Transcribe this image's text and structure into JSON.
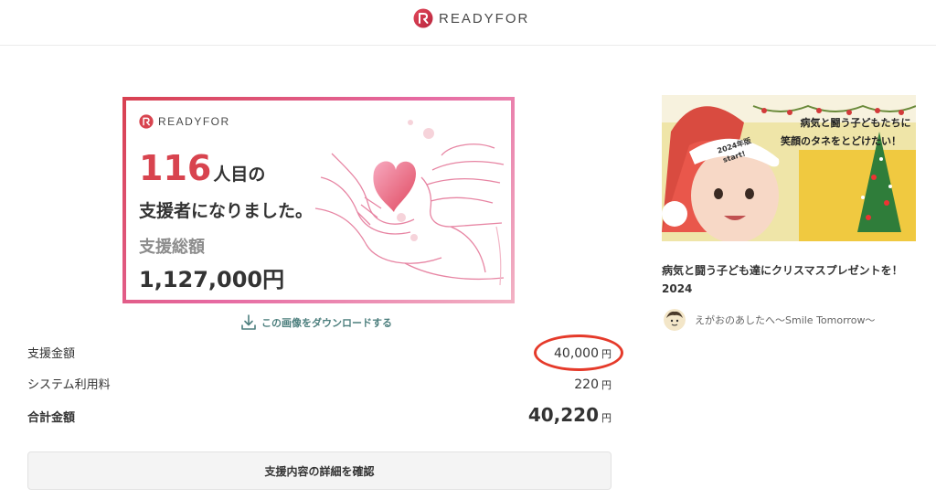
{
  "header": {
    "brand": "READYFOR"
  },
  "card": {
    "brand": "READYFOR",
    "count_number": "116",
    "count_suffix": "人目の",
    "line2": "支援者になりました。",
    "total_label": "支援総額",
    "total_value": "1,127,000円"
  },
  "download": {
    "label": "この画像をダウンロードする"
  },
  "summary": {
    "support_label": "支援金額",
    "support_amount": "40,000",
    "fee_label": "システム利用料",
    "fee_amount": "220",
    "total_label": "合計金額",
    "total_amount": "40,220",
    "unit": "円"
  },
  "detail_button": {
    "label": "支援内容の詳細を確認"
  },
  "project": {
    "image_caption_line1": "病気と闘う子どもたちに",
    "image_caption_line2": "笑顔のタネをとどけたい！",
    "image_badge_line1": "2024年版",
    "image_badge_line2": "start!",
    "title": "病気と闘う子ども達にクリスマスプレゼントを！2024",
    "org_name": "えがおのあしたへ〜Smile Tomorrow〜"
  },
  "colors": {
    "accent": "#d8444f",
    "link": "#4d7f7e",
    "highlight_circle": "#e53a2a"
  },
  "icons": [
    "readyfor-logo-icon",
    "download-icon",
    "heart-hands-illustration",
    "org-avatar-icon"
  ]
}
